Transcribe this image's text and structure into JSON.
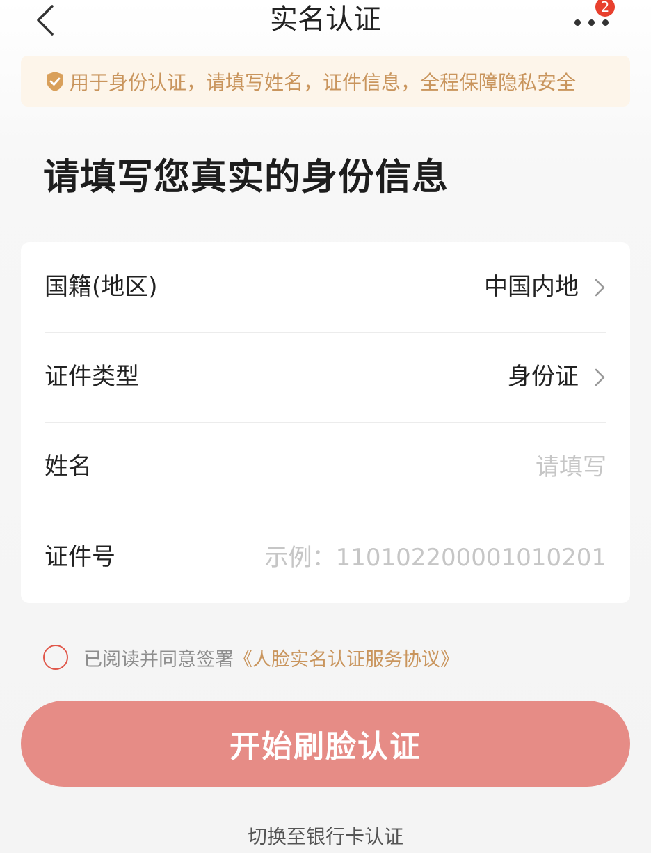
{
  "header": {
    "title": "实名认证",
    "back_icon": "back-chevron-icon",
    "more_icon": "more-dots-icon",
    "badge_count": "2"
  },
  "notice": {
    "icon": "shield-icon",
    "text": "用于身份认证，请填写姓名，证件信息，全程保障隐私安全"
  },
  "heading": "请填写您真实的身份信息",
  "form": {
    "nationality": {
      "label": "国籍(地区)",
      "value": "中国内地"
    },
    "id_type": {
      "label": "证件类型",
      "value": "身份证"
    },
    "name": {
      "label": "姓名",
      "value": "",
      "placeholder": "请填写"
    },
    "id_number": {
      "label": "证件号",
      "value": "",
      "placeholder": "示例：110102200001010201"
    }
  },
  "agreement": {
    "text": "已阅读并同意签署",
    "link": "《人脸实名认证服务协议》",
    "checked": false
  },
  "primary_button": "开始刷脸认证",
  "switch_link": "切换至银行卡认证",
  "colors": {
    "accent": "#e68c86",
    "notice_bg": "#fdf5ea",
    "notice_text": "#c9955d",
    "badge": "#e8402e",
    "radio_border": "#e0574a"
  }
}
